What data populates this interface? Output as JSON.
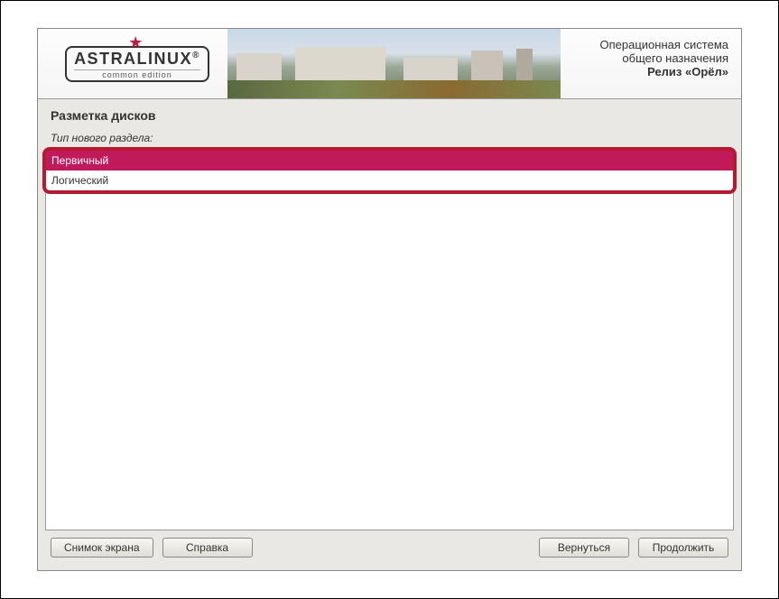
{
  "logo": {
    "main": "Astralinux",
    "sub": "common edition"
  },
  "header": {
    "line1": "Операционная система",
    "line2": "общего назначения",
    "line3": "Релиз «Орёл»"
  },
  "page": {
    "title": "Разметка дисков",
    "subtitle": "Тип нового раздела:"
  },
  "options": {
    "primary": "Первичный",
    "logical": "Логический"
  },
  "buttons": {
    "screenshot": "Снимок экрана",
    "help": "Справка",
    "back": "Вернуться",
    "continue": "Продолжить"
  }
}
